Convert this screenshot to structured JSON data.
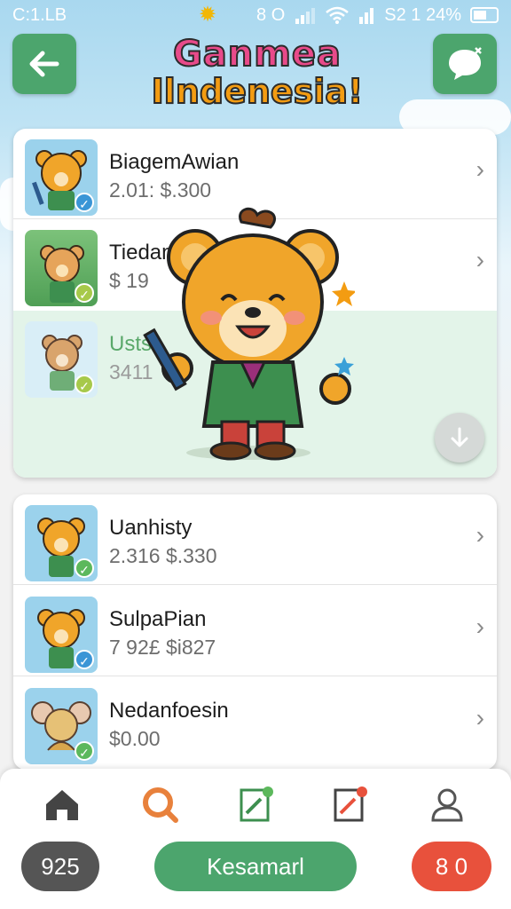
{
  "status_bar": {
    "left_text": "C:1.LB",
    "network_text": "8 O",
    "right_text": "S2 1 24%"
  },
  "header": {
    "title_line1": "Ganmea",
    "title_line2": "Ilndenesia!"
  },
  "list_top": [
    {
      "title": "BiagemAwian",
      "subtitle": "2.01:  $.300"
    },
    {
      "title": "Tiedan",
      "subtitle": "$ 19"
    },
    {
      "title": "Usts",
      "subtitle": "3411"
    }
  ],
  "list_bottom": [
    {
      "title": "Uanhisty",
      "subtitle": "2.316  $.330"
    },
    {
      "title": "SulpaPian",
      "subtitle": "7 92£  $i827"
    },
    {
      "title": "Nedanfoesin",
      "subtitle": "$0.00"
    }
  ],
  "bottom_bar": {
    "left_pill": "925",
    "center_pill": "Kesamarl",
    "right_pill": "8 0"
  },
  "colors": {
    "accent_green": "#4ca56d",
    "search_orange": "#e8813c",
    "pill_red": "#e8513c",
    "pill_gray": "#555555"
  }
}
